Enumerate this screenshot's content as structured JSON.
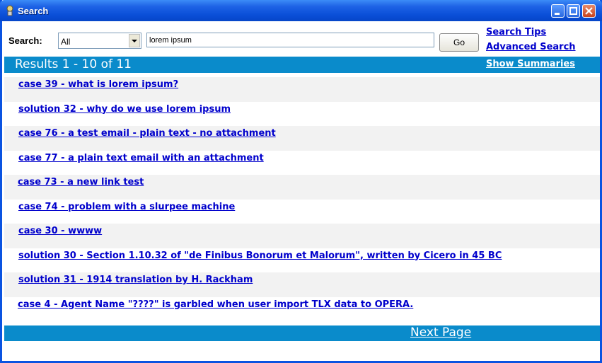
{
  "window": {
    "title": "Search"
  },
  "search": {
    "label": "Search:",
    "scope_selected": "All",
    "query": "lorem ipsum",
    "go_label": "Go",
    "tips_label": "Search Tips",
    "advanced_label": "Advanced Search"
  },
  "results_header": {
    "count_text": "Results 1 - 10 of 11",
    "show_summaries_label": "Show Summaries"
  },
  "results": [
    "case 39 - what is lorem ipsum?",
    "solution 32 - why do we use lorem ipsum",
    "case 76 - a test email - plain text - no attachment",
    "case 77 - a plain text email with an attachment",
    "case 73 - a new link test",
    "case 74 - problem with a slurpee machine",
    "case 30 - wwww",
    "solution 30 - Section 1.10.32 of \"de Finibus Bonorum et Malorum\", written by Cicero in 45 BC",
    "solution 31 - 1914 translation by H. Rackham",
    "case 4 - Agent Name \"????\" is garbled when user import TLX data to OPERA."
  ],
  "footer": {
    "next_label": "Next Page"
  }
}
